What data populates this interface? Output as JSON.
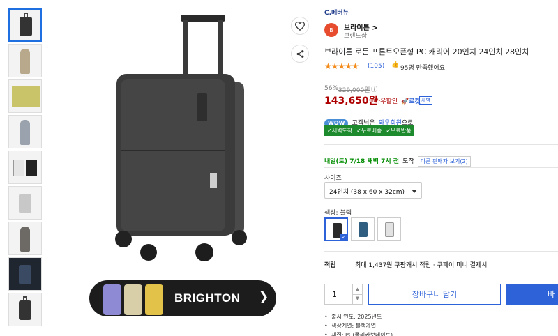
{
  "brand_bar": {
    "logo_text": "C.메버뉴"
  },
  "seller": {
    "name": "브라이튼 >",
    "subtitle": "브랜드샵",
    "logo_glyph": "B"
  },
  "product": {
    "title": "브라이튼 로든 프론트오픈형 PC 캐리어 20인치 24인치 28인치",
    "rating_stars": "★★★★★",
    "review_count": "(105)",
    "satisfaction": "95명 만족했어요",
    "thumb_icon": "thumbs-up-icon"
  },
  "price": {
    "discount": "56%",
    "original": "329,000원",
    "info_icon": "ⓘ",
    "current": "143,650원",
    "wow_label": "와우할인",
    "rocket_label": "🚀로켓",
    "rocket_tag": "새벽"
  },
  "wow": {
    "pill": "WOW",
    "text_prefix": "고객님은",
    "member": "와우회원",
    "text_suffix": "으로",
    "benefits": [
      "✓새벽도착",
      "✓무료배송",
      "✓무료반품"
    ]
  },
  "delivery": {
    "date_text": "내일(토) 7/18 새벽 7시 전",
    "arrive": "도착",
    "other_seller": "다른 판매자 보기(2)"
  },
  "size": {
    "label": "사이즈",
    "selected": "24인치 (38 x 60 x 32cm)"
  },
  "color": {
    "label": "색상: 블랙",
    "swatches": [
      "black",
      "navy",
      "grey"
    ]
  },
  "reward": {
    "label": "적립",
    "text_prefix": "최대 1,437원",
    "cash": "쿠팡캐시 적립",
    "text_suffix": "· 쿠페이 머니 결제시"
  },
  "purchase": {
    "quantity": "1",
    "up": "▲",
    "down": "▼",
    "cart_label": "장바구니 담기",
    "buy_label": "바"
  },
  "specs": [
    "출시 연도: 2025년도",
    "색상계열: 블랙계열",
    "재질: PC(폴리카보네이트)"
  ],
  "banner": {
    "brand": "BRIGHTON",
    "arrow": "❯"
  },
  "colors": {
    "accent": "#2e62d8",
    "price_red": "#ae0000",
    "green": "#1e8a2e",
    "star": "#f28b1a"
  }
}
